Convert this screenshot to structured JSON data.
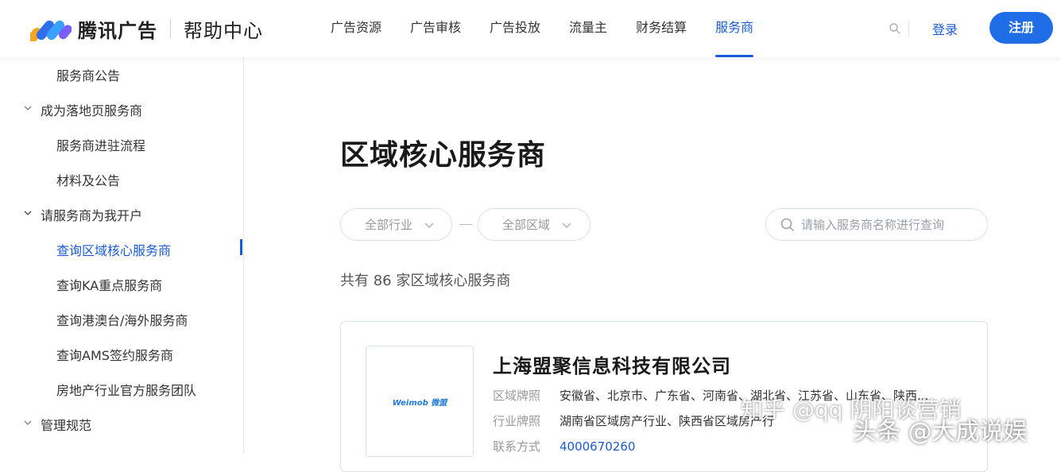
{
  "header": {
    "brand": "腾讯广告",
    "help_center": "帮助中心",
    "nav": [
      "广告资源",
      "广告审核",
      "广告投放",
      "流量主",
      "财务结算",
      "服务商"
    ],
    "active_nav": "服务商",
    "login": "登录",
    "register": "注册"
  },
  "sidebar": {
    "items": [
      {
        "label": "服务商公告",
        "kind": "sub"
      },
      {
        "label": "成为落地页服务商",
        "kind": "group"
      },
      {
        "label": "服务商进驻流程",
        "kind": "sub"
      },
      {
        "label": "材料及公告",
        "kind": "sub"
      },
      {
        "label": "请服务商为我开户",
        "kind": "group"
      },
      {
        "label": "查询区域核心服务商",
        "kind": "sub",
        "active": true
      },
      {
        "label": "查询KA重点服务商",
        "kind": "sub"
      },
      {
        "label": "查询港澳台/海外服务商",
        "kind": "sub"
      },
      {
        "label": "查询AMS签约服务商",
        "kind": "sub"
      },
      {
        "label": "房地产行业官方服务团队",
        "kind": "sub"
      },
      {
        "label": "管理规范",
        "kind": "group"
      }
    ]
  },
  "main": {
    "title": "区域核心服务商",
    "filter_industry": "全部行业",
    "filter_region": "全部区域",
    "search_placeholder": "请输入服务商名称进行查询",
    "count_text": "共有 86 家区域核心服务商"
  },
  "card": {
    "logo_text": "Weimob 微盟",
    "company": "上海盟聚信息科技有限公司",
    "region_label": "区域牌照",
    "region_value": "安徽省、北京市、广东省、河南省、湖北省、江苏省、山东省、陕西...",
    "industry_label": "行业牌照",
    "industry_value": "湖南省区域房产行业、陕西省区域房产行",
    "contact_label": "联系方式",
    "contact_value": "4000670260"
  },
  "watermarks": {
    "zhihu": "知乎 @qq 阴阳谈营销",
    "toutiao": "头条 @大成说娱"
  },
  "colors": {
    "accent": "#1a5cd6",
    "register_bg": "#1f6ee8",
    "border": "#d7e2f2"
  }
}
